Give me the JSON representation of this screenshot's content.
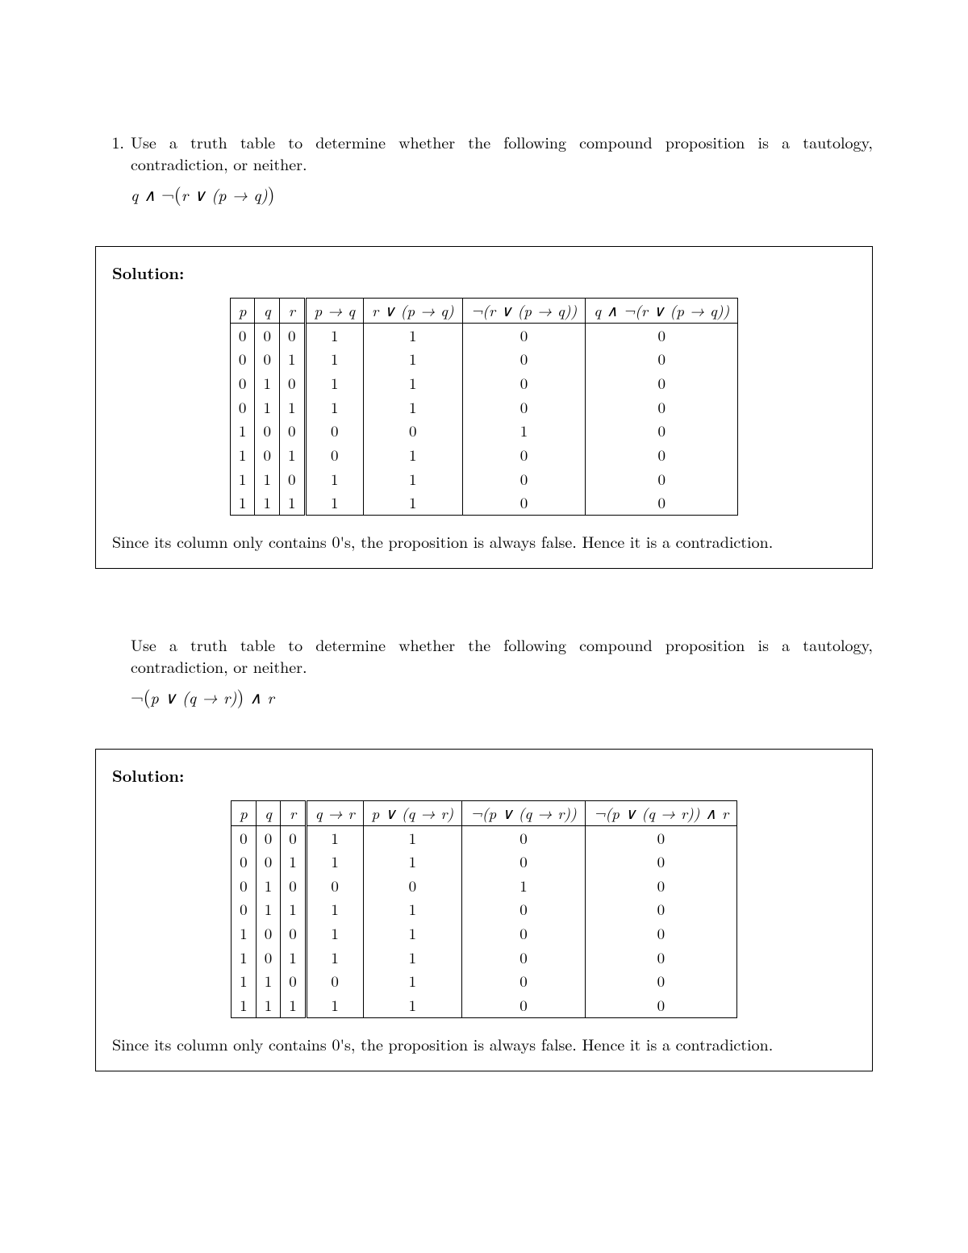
{
  "problem_number": "1.",
  "prompt": "Use a truth table to determine whether the following compound proposition is a tautology, contradiction, or neither.",
  "solution_label": "Solution:",
  "conclusion": "Since its column only contains 0's, the proposition is always false. Hence it is a contradiction.",
  "p1": {
    "formula_html": "<span>q</span> ∧ <span class='neg'>¬</span><span class='lparen big'>(</span><span>r</span> ∨ (<span>p</span> → <span>q</span>)<span class='rparen big'>)</span>",
    "headers": [
      "p",
      "q",
      "r",
      "p → q",
      "r ∨ (p → q)",
      "¬(r ∨ (p → q))",
      "q ∧ ¬(r ∨ (p → q))"
    ],
    "rows": [
      [
        "0",
        "0",
        "0",
        "1",
        "1",
        "0",
        "0"
      ],
      [
        "0",
        "0",
        "1",
        "1",
        "1",
        "0",
        "0"
      ],
      [
        "0",
        "1",
        "0",
        "1",
        "1",
        "0",
        "0"
      ],
      [
        "0",
        "1",
        "1",
        "1",
        "1",
        "0",
        "0"
      ],
      [
        "1",
        "0",
        "0",
        "0",
        "0",
        "1",
        "0"
      ],
      [
        "1",
        "0",
        "1",
        "0",
        "1",
        "0",
        "0"
      ],
      [
        "1",
        "1",
        "0",
        "1",
        "1",
        "0",
        "0"
      ],
      [
        "1",
        "1",
        "1",
        "1",
        "1",
        "0",
        "0"
      ]
    ]
  },
  "p2": {
    "formula_html": "<span class='neg'>¬</span><span class='lparen big'>(</span><span>p</span> ∨ (<span>q</span> → <span>r</span>)<span class='rparen big'>)</span> ∧ <span>r</span>",
    "headers": [
      "p",
      "q",
      "r",
      "q → r",
      "p ∨ (q → r)",
      "¬(p ∨ (q → r))",
      "¬(p ∨ (q → r)) ∧ r"
    ],
    "rows": [
      [
        "0",
        "0",
        "0",
        "1",
        "1",
        "0",
        "0"
      ],
      [
        "0",
        "0",
        "1",
        "1",
        "1",
        "0",
        "0"
      ],
      [
        "0",
        "1",
        "0",
        "0",
        "0",
        "1",
        "0"
      ],
      [
        "0",
        "1",
        "1",
        "1",
        "1",
        "0",
        "0"
      ],
      [
        "1",
        "0",
        "0",
        "1",
        "1",
        "0",
        "0"
      ],
      [
        "1",
        "0",
        "1",
        "1",
        "1",
        "0",
        "0"
      ],
      [
        "1",
        "1",
        "0",
        "0",
        "1",
        "0",
        "0"
      ],
      [
        "1",
        "1",
        "1",
        "1",
        "1",
        "0",
        "0"
      ]
    ]
  }
}
